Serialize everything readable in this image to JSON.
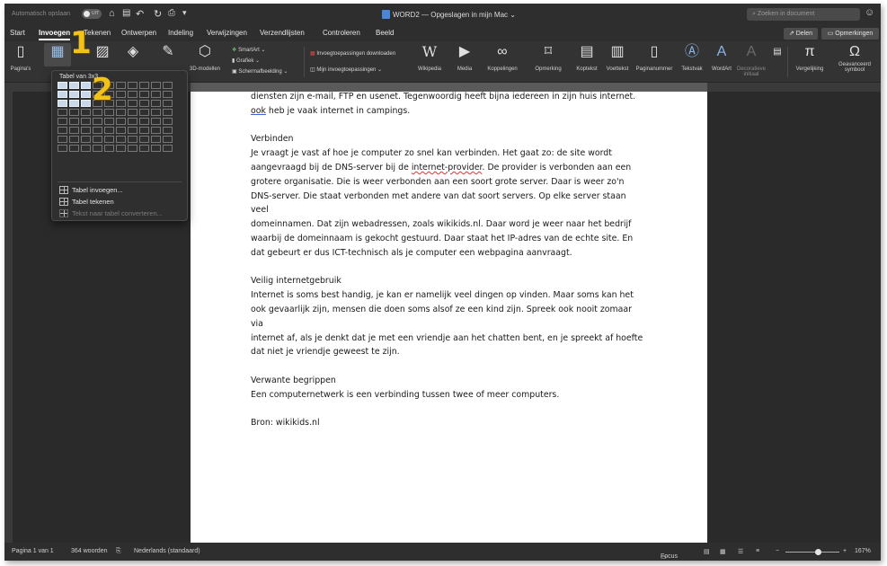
{
  "titlebar": {
    "autosave_label": "Automatisch opslaan",
    "autosave_state": "UIT",
    "document_title": "WORD2 — Opgeslagen in mijn Mac",
    "search_placeholder": "Zoeken in document"
  },
  "tabs": [
    {
      "label": "Start",
      "active": false
    },
    {
      "label": "Invoegen",
      "active": true
    },
    {
      "label": "Tekenen",
      "active": false
    },
    {
      "label": "Ontwerpen",
      "active": false
    },
    {
      "label": "Indeling",
      "active": false
    },
    {
      "label": "Verwijzingen",
      "active": false
    },
    {
      "label": "Verzendlijsten",
      "active": false
    },
    {
      "label": "Controleren",
      "active": false
    },
    {
      "label": "Beeld",
      "active": false
    }
  ],
  "header_buttons": {
    "share": "Delen",
    "comments": "Opmerkingen"
  },
  "ribbon": {
    "pages": "Pagina's",
    "models_3d": "3D-modellen",
    "smartart": "SmartArt",
    "chart": "Grafiek",
    "screenshot": "Schermafbeelding",
    "addins_download": "Invoegtoepassingen downloaden",
    "my_addins": "Mijn invoegtoepassingen",
    "wikipedia": "Wikipedia",
    "media": "Media",
    "links": "Koppelingen",
    "comment": "Opmerking",
    "header": "Koptekst",
    "footer": "Voettekst",
    "page_number": "Paginanummer",
    "textbox": "Tekstvak",
    "wordart": "WordArt",
    "dropcap": "Decoratieve initiaal",
    "equation": "Vergelijking",
    "symbol": "Geavanceerd symbool"
  },
  "table_menu": {
    "title": "Tabel van 3x3",
    "grid_cols": 10,
    "grid_rows": 8,
    "selected_cols": 3,
    "selected_rows": 3,
    "items": [
      {
        "label": "Tabel invoegen...",
        "enabled": true
      },
      {
        "label": "Tabel tekenen",
        "enabled": true
      },
      {
        "label": "Tekst naar tabel converteren...",
        "enabled": false
      }
    ]
  },
  "callouts": {
    "one": "1",
    "two": "2"
  },
  "document": {
    "paragraphs": [
      {
        "type": "line",
        "text": "diensten zijn e-mail, FTP en usenet. Tegenwoordig heeft bijna iedereen in zijn huis internet."
      },
      {
        "type": "line_ook",
        "pre": "ook",
        "text": " heb je vaak internet in campings."
      },
      {
        "type": "gap"
      },
      {
        "type": "line",
        "text": "Verbinden"
      },
      {
        "type": "line",
        "text": "Je vraagt je vast af hoe je computer zo snel kan verbinden. Het gaat zo: de site wordt"
      },
      {
        "type": "line_provider",
        "pre": "aangevraagd bij de DNS-server bij de ",
        "link": "internet-provider",
        "post": ". De provider is verbonden aan een"
      },
      {
        "type": "line",
        "text": "grotere organisatie. Die is weer verbonden aan een soort grote server. Daar is weer zo'n"
      },
      {
        "type": "line",
        "text": "DNS-server. Die staat verbonden met andere van dat soort servers. Op elke server staan veel"
      },
      {
        "type": "line",
        "text": "domeinnamen. Dat zijn webadressen, zoals wikikids.nl. Daar word je weer naar het bedrijf"
      },
      {
        "type": "line",
        "text": "waarbij de domeinnaam is gekocht gestuurd. Daar staat het IP-adres van de echte site. En"
      },
      {
        "type": "line",
        "text": "dat gebeurt er dus ICT-technisch als je computer een webpagina aanvraagt."
      },
      {
        "type": "gap"
      },
      {
        "type": "line",
        "text": "Veilig internetgebruik"
      },
      {
        "type": "line",
        "text": "Internet is soms best handig, je kan er namelijk veel dingen op vinden. Maar soms kan het"
      },
      {
        "type": "line",
        "text": "ook gevaarlijk zijn, mensen die doen soms alsof ze een kind zijn. Spreek ook nooit zomaar via"
      },
      {
        "type": "line",
        "text": "internet af, als je denkt dat je met een vriendje aan het chatten bent, en je spreekt af hoefte"
      },
      {
        "type": "line",
        "text": "dat niet je vriendje geweest te zijn."
      },
      {
        "type": "gap"
      },
      {
        "type": "line",
        "text": "Verwante begrippen"
      },
      {
        "type": "line",
        "text": "Een computernetwerk is een verbinding tussen twee of meer computers."
      },
      {
        "type": "gap"
      },
      {
        "type": "line",
        "text": "Bron: wikikids.nl"
      }
    ]
  },
  "status": {
    "page": "Pagina 1 van 1",
    "words": "364 woorden",
    "language": "Nederlands (standaard)",
    "focus": "Focus",
    "zoom": "167%",
    "zoom_fraction": 0.6
  },
  "colors": {
    "accent": "#f3c21a",
    "ribbon_bg": "#333333",
    "selected_cell": "#c8d8ea"
  }
}
